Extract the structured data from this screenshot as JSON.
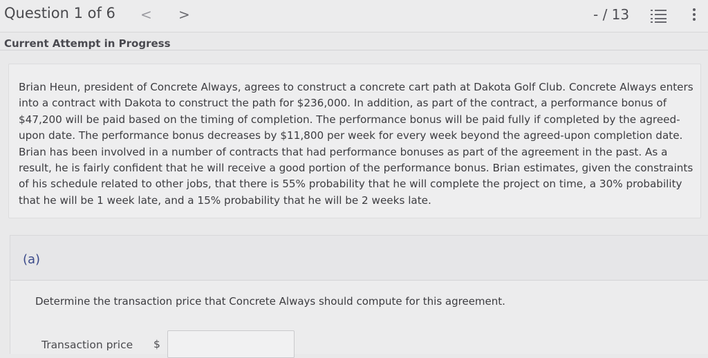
{
  "header": {
    "question_title": "Question 1 of 6",
    "prev_icon": "chevron-left-icon",
    "prev_glyph": "<",
    "next_icon": "chevron-right-icon",
    "next_glyph": ">",
    "score": "- / 13",
    "list_icon": "numbered-list-icon",
    "more_icon": "more-vertical-icon"
  },
  "status": "Current Attempt in Progress",
  "question": {
    "text": "Brian Heun, president of Concrete Always, agrees to construct a concrete cart path at Dakota Golf Club. Concrete Always enters into a contract with Dakota to construct the path for $236,000. In addition, as part of the contract, a performance bonus of $47,200 will be paid based on the timing of completion. The performance bonus will be paid fully if completed by the agreed-upon date. The performance bonus decreases by $11,800 per week for every week beyond the agreed-upon completion date. Brian has been involved in a number of contracts that had performance bonuses as part of the agreement in the past. As a result, he is fairly confident that he will receive a good portion of the performance bonus. Brian estimates, given the constraints of his schedule related to other jobs, that there is 55% probability that he will complete the project on time, a 30% probability that he will be 1 week late, and a 15% probability that he will be 2 weeks late."
  },
  "part_a": {
    "label": "(a)",
    "instruction": "Determine the transaction price that Concrete Always should compute for this agreement.",
    "field_label": "Transaction price",
    "currency_symbol": "$",
    "value": ""
  },
  "colors": {
    "part_label": "#3b4a8a",
    "background": "#e9e9ea"
  }
}
